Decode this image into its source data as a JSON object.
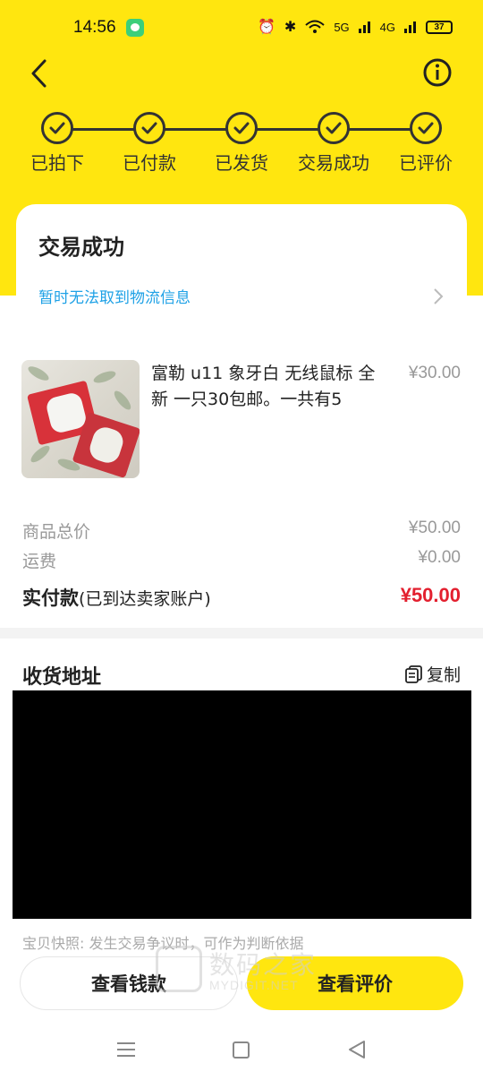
{
  "status_bar": {
    "time": "14:56",
    "network1": "5G",
    "network2": "4G",
    "battery": "37",
    "icons": [
      "chat-icon",
      "alarm-icon",
      "bluetooth-icon",
      "wifi-icon",
      "signal-icon"
    ]
  },
  "header": {
    "icons": [
      "back-arrow-icon",
      "info-icon"
    ]
  },
  "steps": [
    {
      "label": "已拍下"
    },
    {
      "label": "已付款"
    },
    {
      "label": "已发货"
    },
    {
      "label": "交易成功"
    },
    {
      "label": "已评价"
    }
  ],
  "status_card": {
    "title": "交易成功",
    "logistics": "暂时无法取到物流信息"
  },
  "product": {
    "title": "富勒 u11 象牙白 无线鼠标 全新 一只30包邮。一共有5",
    "price": "¥30.00"
  },
  "summary": {
    "total_label": "商品总价",
    "total_value": "¥50.00",
    "shipping_label": "运费",
    "shipping_value": "¥0.00",
    "paid_label": "实付款",
    "paid_note": "(已到达卖家账户)",
    "paid_value": "¥50.00"
  },
  "address": {
    "title": "收货地址",
    "copy_label": "复制"
  },
  "snapshot": "宝贝快照: 发生交易争议时，可作为判断依据",
  "actions": {
    "view_money": "查看钱款",
    "view_review": "查看评价"
  },
  "watermark": {
    "text": "数码之家",
    "sub": "MYDIGIT.NET"
  },
  "colors": {
    "brand_yellow": "#ffe60f",
    "link_blue": "#1ea1e6",
    "price_red": "#e3202f"
  }
}
